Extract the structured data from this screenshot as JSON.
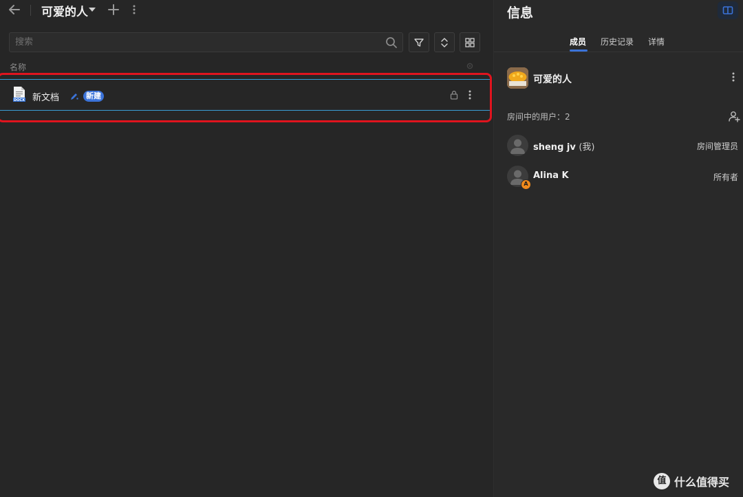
{
  "header": {
    "room_title": "可爱的人",
    "back": "back-arrow-icon",
    "add": "plus-icon",
    "more": "more-vertical-icon"
  },
  "search": {
    "placeholder": "搜索",
    "value": ""
  },
  "toolbar": {
    "filter": "filter-icon",
    "sort": "sort-icon",
    "view": "grid-view-icon"
  },
  "file_list": {
    "column_header": "名称",
    "rows": [
      {
        "name": "新文档",
        "file_type_label": "DOCX",
        "badge": "新建",
        "icons": [
          "docx-file-icon",
          "edit-icon",
          "lock-icon",
          "more-vertical-icon"
        ]
      }
    ]
  },
  "info_panel": {
    "title": "信息",
    "tabs": [
      {
        "label": "成员",
        "active": true
      },
      {
        "label": "历史记录",
        "active": false
      },
      {
        "label": "详情",
        "active": false
      }
    ],
    "room_name": "可爱的人",
    "users_label": "房间中的用户：2",
    "members": [
      {
        "name": "sheng jv",
        "me_label": "(我)",
        "role": "房间管理员"
      },
      {
        "name": "Alina K",
        "me_label": "",
        "role": "所有者",
        "badge": "A"
      }
    ]
  },
  "watermark": {
    "logo": "值",
    "text": "什么值得买"
  },
  "colors": {
    "background": "#262626",
    "panel": "#292929",
    "accent": "#3b73d9",
    "row_border": "#3aa0d8",
    "highlight": "#e0141e",
    "owner_badge": "#f08a1c"
  }
}
